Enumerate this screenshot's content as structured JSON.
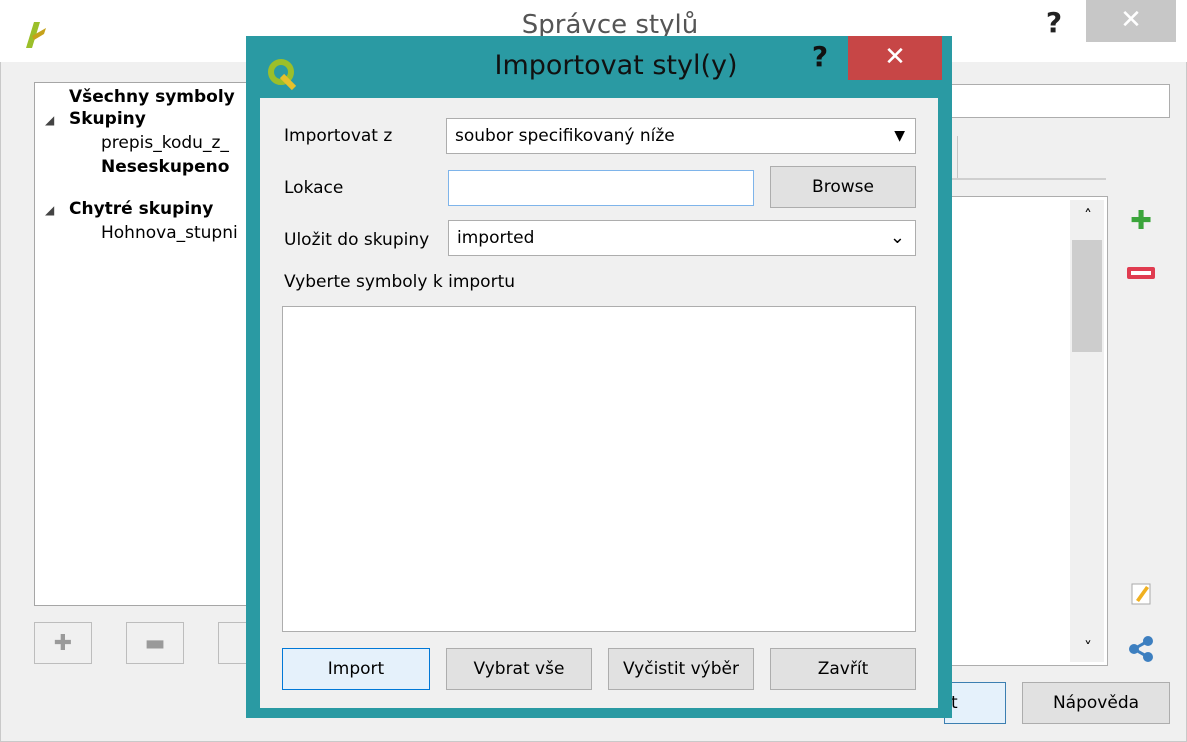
{
  "background_window": {
    "title": "Správce stylů",
    "help_icon": "?",
    "close_icon": "✕",
    "logo_icon": "qgis-logo-icon",
    "tree": {
      "all_symbols": "Všechny symboly",
      "groups_header": "Skupiny",
      "group_item_1": "prepis_kodu_z_",
      "ungrouped": "Neseskupeno",
      "smart_groups_header": "Chytré skupiny",
      "smart_group_item_1": "Hohnova_stupni"
    },
    "bottom_tools": [
      "add-group-icon",
      "remove-group-icon"
    ],
    "side_tools": [
      "add-symbol-icon",
      "remove-symbol-icon",
      "edit-symbol-icon",
      "share-menu-icon"
    ],
    "buttons": {
      "partial_label": "t",
      "help_label": "Nápověda"
    }
  },
  "import_dialog": {
    "title": "Importovat styl(y)",
    "help_icon": "?",
    "close_icon": "✕",
    "logo_icon": "qgis-logo-icon",
    "import_from_label": "Importovat z",
    "import_from_value": "soubor specifikovaný níže",
    "location_label": "Lokace",
    "location_value": "",
    "browse_label": "Browse",
    "save_group_label": "Uložit do skupiny",
    "save_group_value": "imported",
    "symbols_label": "Vyberte symboly k importu",
    "buttons": {
      "import": "Import",
      "select_all": "Vybrat vše",
      "clear_selection": "Vyčistit výběr",
      "close": "Zavřít"
    }
  }
}
